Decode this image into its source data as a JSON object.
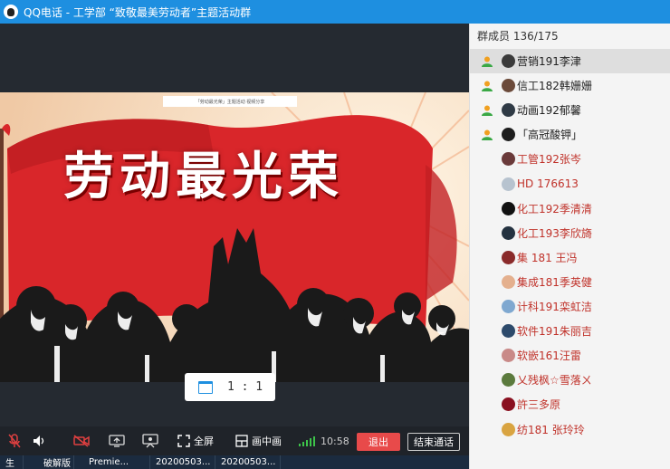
{
  "window": {
    "title": "QQ电话 - 工学部 “致敬最美劳动者”主题活动群"
  },
  "video": {
    "caption": "「劳动最光荣」主题活动  视频分享",
    "headline": "劳动最光荣",
    "ratio_label": "1 : 1"
  },
  "toolbar": {
    "fullscreen_label": "全屏",
    "pip_label": "画中画",
    "time": "10:58",
    "exit_label": "退出",
    "end_call_label": "结束通话"
  },
  "taskbar": [
    "生",
    "破解版",
    "Premie...",
    "20200503...",
    "20200503..."
  ],
  "panel": {
    "header": "群成员 136/175"
  },
  "members": [
    {
      "name": "营销191李津",
      "admin": true,
      "selected": true,
      "avatar_color": "#3b3b3b"
    },
    {
      "name": "信工182韩姗姗",
      "admin": true,
      "selected": false,
      "avatar_color": "#6b4a3a"
    },
    {
      "name": "动画192郁馨",
      "admin": true,
      "selected": false,
      "avatar_color": "#2f3a45"
    },
    {
      "name": "「高冠酸钾」",
      "admin": true,
      "selected": false,
      "avatar_color": "#1e1e1e"
    },
    {
      "name": "工管192张岑",
      "admin": false,
      "selected": false,
      "avatar_color": "#6a3a3a"
    },
    {
      "name": "HD 176613",
      "admin": false,
      "selected": false,
      "avatar_color": "#b7c3cf"
    },
    {
      "name": "化工192季清清",
      "admin": false,
      "selected": false,
      "avatar_color": "#111111"
    },
    {
      "name": "化工193李欣旖",
      "admin": false,
      "selected": false,
      "avatar_color": "#243240"
    },
    {
      "name": "集 181  王冯",
      "admin": false,
      "selected": false,
      "avatar_color": "#8a2a2a"
    },
    {
      "name": "集成181季英健",
      "admin": false,
      "selected": false,
      "avatar_color": "#e4b08e"
    },
    {
      "name": "计科191栾虹洁",
      "admin": false,
      "selected": false,
      "avatar_color": "#7fa8d0"
    },
    {
      "name": "软件191朱丽吉",
      "admin": false,
      "selected": false,
      "avatar_color": "#2d4a6b"
    },
    {
      "name": "软嵌161汪雷",
      "admin": false,
      "selected": false,
      "avatar_color": "#c98a88"
    },
    {
      "name": "乂残枫☆雪落ㄨ",
      "admin": false,
      "selected": false,
      "avatar_color": "#5b7a3d"
    },
    {
      "name": "許三多原",
      "admin": false,
      "selected": false,
      "avatar_color": "#8a1020"
    },
    {
      "name": "纺181 张玲玲",
      "admin": false,
      "selected": false,
      "avatar_color": "#d9a441"
    }
  ],
  "colors": {
    "titlebar": "#1e8fe0",
    "poster_red": "#d9262a",
    "exit_button": "#e84a4a",
    "member_name": "#c0322a"
  }
}
